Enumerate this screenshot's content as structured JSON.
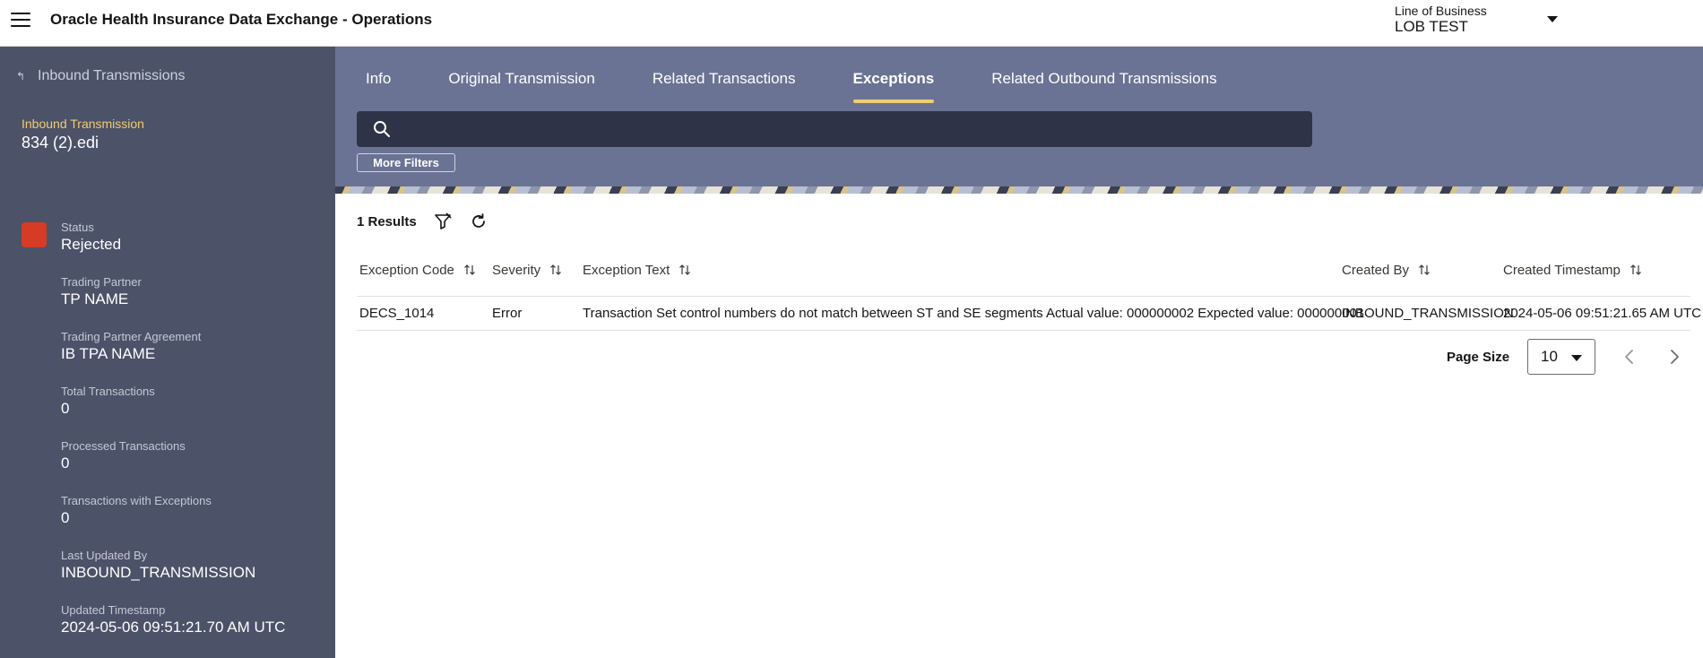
{
  "header": {
    "title": "Oracle Health Insurance Data Exchange - Operations",
    "lob_label": "Line of Business",
    "lob_value": "LOB TEST"
  },
  "sidebar": {
    "back_label": "Inbound Transmissions",
    "entity_label": "Inbound Transmission",
    "entity_name": "834 (2).edi",
    "status": {
      "label": "Status",
      "value": "Rejected",
      "color": "#d63b25"
    },
    "fields": [
      {
        "label": "Trading Partner",
        "value": "TP NAME"
      },
      {
        "label": "Trading Partner Agreement",
        "value": "IB TPA NAME"
      },
      {
        "label": "Total Transactions",
        "value": "0"
      },
      {
        "label": "Processed Transactions",
        "value": "0"
      },
      {
        "label": "Transactions with Exceptions",
        "value": "0"
      },
      {
        "label": "Last Updated By",
        "value": "INBOUND_TRANSMISSION"
      },
      {
        "label": "Updated Timestamp",
        "value": "2024-05-06 09:51:21.70 AM UTC"
      }
    ]
  },
  "tabs": [
    {
      "label": "Info",
      "active": false
    },
    {
      "label": "Original Transmission",
      "active": false
    },
    {
      "label": "Related Transactions",
      "active": false
    },
    {
      "label": "Exceptions",
      "active": true
    },
    {
      "label": "Related Outbound Transmissions",
      "active": false
    }
  ],
  "search": {
    "value": "",
    "placeholder": ""
  },
  "filters": {
    "more_filters_label": "More Filters"
  },
  "results": {
    "count_label": "1 Results"
  },
  "table": {
    "columns": [
      "Exception Code",
      "Severity",
      "Exception Text",
      "Created By",
      "Created Timestamp"
    ],
    "rows": [
      {
        "exception_code": "DECS_1014",
        "severity": "Error",
        "exception_text": "Transaction Set control numbers do not match between ST and SE segments Actual value: 000000002 Expected value: 000000001",
        "created_by": "INBOUND_TRANSMISSION",
        "created_timestamp": "2024-05-06 09:51:21.65 AM UTC"
      }
    ]
  },
  "pager": {
    "page_size_label": "Page Size",
    "page_size_value": "10"
  },
  "colors": {
    "sidebar_bg": "#4c5268",
    "main_top_bg": "#6b7394",
    "accent": "#f0cc71",
    "search_bg": "#2e3347"
  },
  "icons": [
    "hamburger-icon",
    "back-arrow-icon",
    "search-icon",
    "clear-filter-icon",
    "refresh-icon",
    "sort-icon",
    "chevron-left-icon",
    "chevron-right-icon",
    "caret-down-icon"
  ]
}
